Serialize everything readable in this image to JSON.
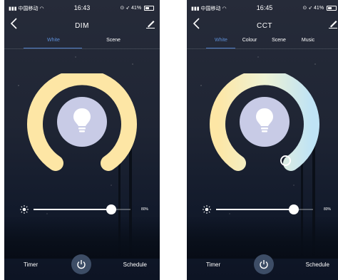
{
  "screens": [
    {
      "status": {
        "carrier": "中国移动",
        "time": "16:43",
        "battery": "41%"
      },
      "title": "DIM",
      "tabs": [
        {
          "label": "White",
          "active": true
        },
        {
          "label": "Scene",
          "active": false
        }
      ],
      "brightness": {
        "value_label": "80%",
        "value": 0.8
      },
      "bottom": {
        "timer_label": "Timer",
        "schedule_label": "Schedule"
      },
      "ring_color": "#fde6a5"
    },
    {
      "status": {
        "carrier": "中国移动",
        "time": "16:45",
        "battery": "41%"
      },
      "title": "CCT",
      "tabs": [
        {
          "label": "White",
          "active": true
        },
        {
          "label": "Colour",
          "active": false
        },
        {
          "label": "Scene",
          "active": false
        },
        {
          "label": "Music",
          "active": false
        }
      ],
      "brightness": {
        "value_label": "80%",
        "value": 0.8
      },
      "bottom": {
        "timer_label": "Timer",
        "schedule_label": "Schedule"
      },
      "ring_colors": {
        "warm": "#fde6a5",
        "cool": "#bfe3f5"
      }
    }
  ],
  "icons": {
    "back": "chevron-left-icon",
    "edit": "edit-icon",
    "bulb": "bulb-icon",
    "sun": "sun-icon",
    "power": "power-icon"
  },
  "colors": {
    "accent": "#5d8ed6",
    "bulb_disc": "#c8cbe6",
    "power_disc": "#3d4d66"
  }
}
